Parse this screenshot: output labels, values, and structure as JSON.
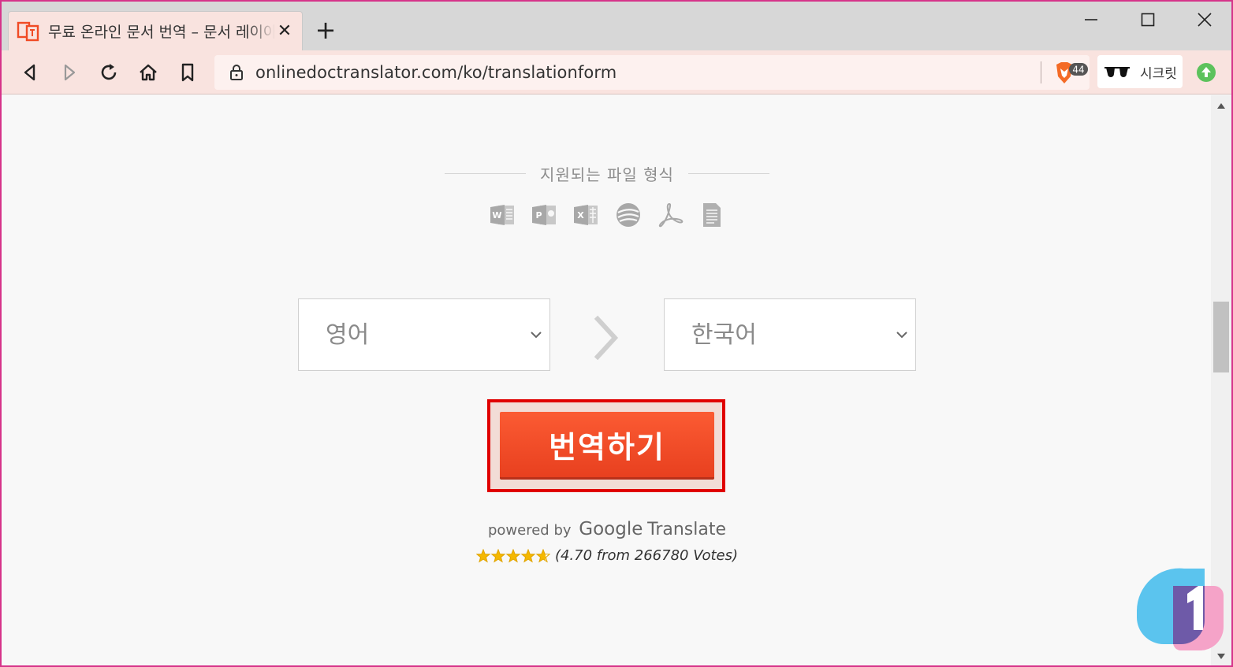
{
  "browser": {
    "tab": {
      "title": "무료 온라인 문서 번역 – 문서 레이아웃 보존",
      "close_glyph": "✕"
    },
    "new_tab_glyph": "+",
    "url": "onlinedoctranslator.com/ko/translationform",
    "shields_count": "44",
    "incognito_label": "시크릿",
    "colors": {
      "tab_active": "#f9e3df",
      "window_border": "#d6338a",
      "update": "#5cc25c"
    }
  },
  "page": {
    "formats_title": "지원되는 파일 형식",
    "format_icons": [
      "word-icon",
      "powerpoint-icon",
      "excel-icon",
      "opendocument-icon",
      "pdf-icon",
      "text-file-icon"
    ],
    "source_language": "영어",
    "target_language": "한국어",
    "translate_button": "번역하기",
    "powered_by": "powered by",
    "google": "Google",
    "google_translate": "Translate",
    "rating_text": "(4.70 from 266780 Votes)",
    "rating_value": 4.7,
    "rating_max": 5,
    "accent_color": "#f04b25"
  }
}
